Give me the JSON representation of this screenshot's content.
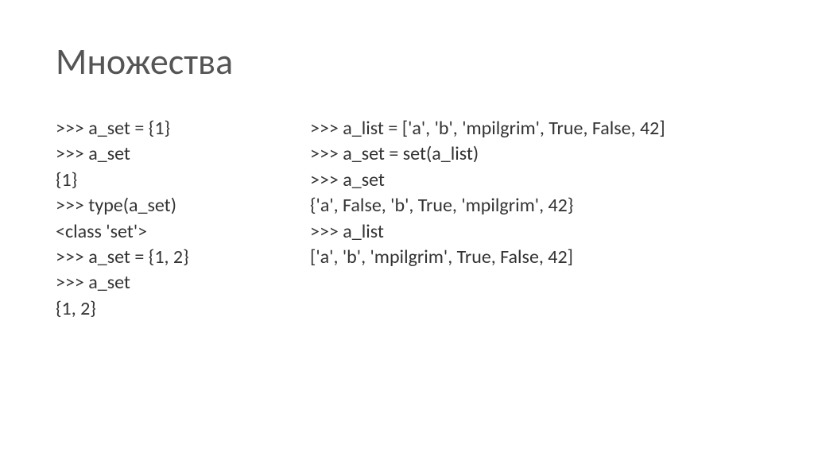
{
  "title": "Множества",
  "left_code": [
    ">>> a_set = {1}",
    ">>> a_set",
    "{1}",
    ">>> type(a_set)",
    "<class 'set'>",
    ">>> a_set = {1, 2}",
    ">>> a_set",
    "{1, 2}"
  ],
  "right_code": [
    ">>> a_list = ['a', 'b', 'mpilgrim', True, False, 42]",
    ">>> a_set = set(a_list)",
    ">>> a_set",
    "{'a', False, 'b', True, 'mpilgrim', 42}",
    ">>> a_list",
    "['a', 'b', 'mpilgrim', True, False, 42]"
  ]
}
